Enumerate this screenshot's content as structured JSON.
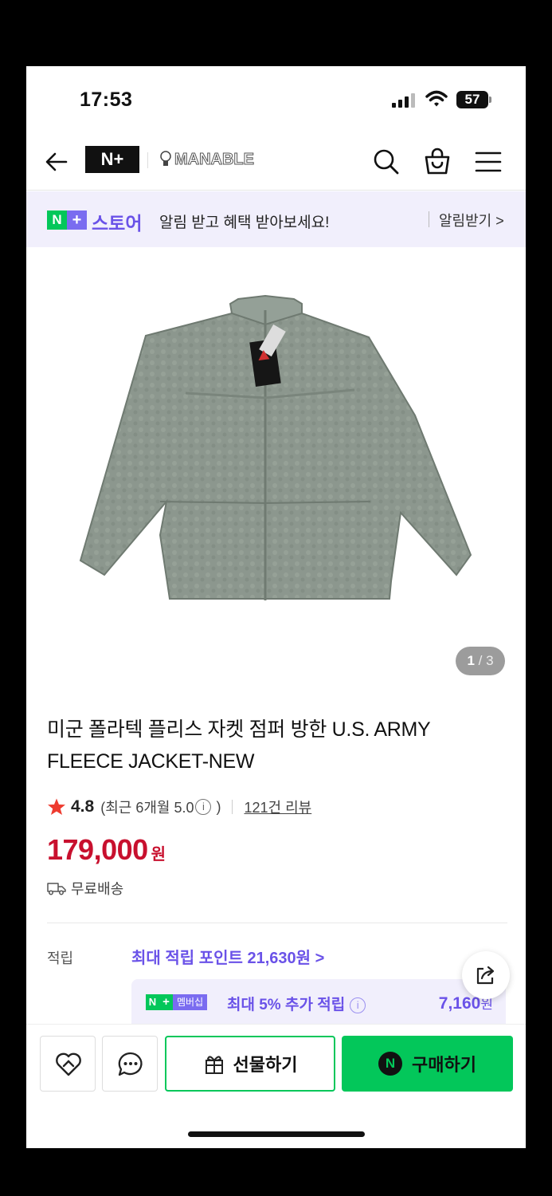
{
  "status_bar": {
    "time": "17:53",
    "battery": "57",
    "icons": [
      "signal-icon",
      "wifi-icon",
      "battery-icon"
    ]
  },
  "header": {
    "logo": "N+",
    "brand": "MANABLE",
    "icons": [
      "back-icon",
      "search-icon",
      "cart-icon",
      "menu-icon"
    ]
  },
  "store_banner": {
    "badge_n": "N",
    "badge_plus": "+",
    "store_name": "스토어",
    "message": "알림 받고 혜택 받아보세요!",
    "alarm_label": "알림받기 >"
  },
  "gallery": {
    "current": "1",
    "total": "/ 3"
  },
  "product": {
    "title": "미군 폴라텍 플리스 자켓 점퍼 방한 U.S. ARMY FLEECE JACKET-NEW",
    "rating": "4.8",
    "recent_rating_prefix": "(최근 6개월 5.0",
    "recent_rating_suffix": ")",
    "info_glyph": "i",
    "review_count": "121건 리뷰",
    "price": "179,000",
    "price_unit": "원",
    "shipping": "무료배송"
  },
  "points": {
    "label": "적립",
    "max_points_text": "최대 적립 포인트 21,630원 >",
    "member_label": "멤버십",
    "member_text": "최대 5% 추가 적립",
    "member_amount": "7,160",
    "member_amount_unit": "원"
  },
  "bottom_bar": {
    "gift_label": "선물하기",
    "buy_label": "구매하기",
    "npay_glyph": "N"
  },
  "colors": {
    "naver_green": "#03c75a",
    "plus_purple": "#6a52e8",
    "price_red": "#c8102e",
    "jacket": "#8a958c"
  }
}
